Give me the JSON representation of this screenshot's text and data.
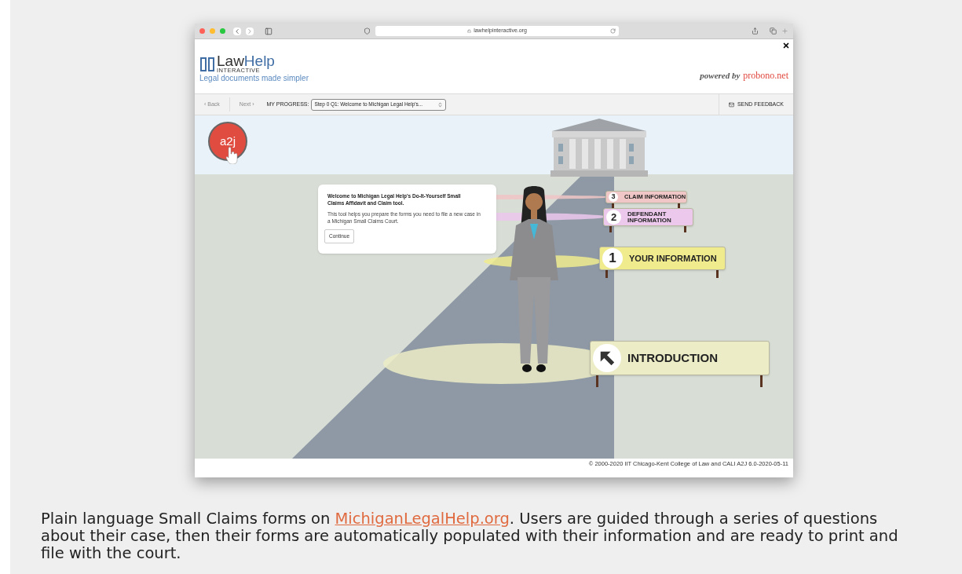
{
  "browser": {
    "url": "lawhelpinteractive.org"
  },
  "header": {
    "logo_a": "Law",
    "logo_b": "Help",
    "logo_sub": "INTERACTIVE",
    "tagline": "Legal documents made simpler",
    "powered_prefix": "powered by",
    "powered_brand": "probono.net"
  },
  "nav": {
    "back": {
      "label": "‹ Back",
      "disabled": true
    },
    "next": {
      "label": "Next ›",
      "disabled": true
    },
    "progress_label": "MY PROGRESS:",
    "progress_value": "Step 0 Q1: Welcome to Michigan Legal Help's...",
    "feedback": "SEND FEEDBACK"
  },
  "badge": "a2j",
  "dialog": {
    "title": "Welcome to Michigan Legal Help's Do-It-Yourself Small Claims Affidavit and Claim tool.",
    "body": "This tool helps you prepare the forms you need to file a new case in a Michigan Small Claims Court.",
    "button": "Continue"
  },
  "signs": [
    {
      "kind": "number",
      "number": "3",
      "label": "CLAIM INFORMATION",
      "color": "#f0c6c6"
    },
    {
      "kind": "number",
      "number": "2",
      "label": "DEFENDANT INFORMATION",
      "color": "#ecc8ec"
    },
    {
      "kind": "number",
      "number": "1",
      "label": "YOUR INFORMATION",
      "color": "#f0ec8e"
    },
    {
      "kind": "arrow",
      "label": "INTRODUCTION",
      "color": "#ececc6"
    }
  ],
  "footer": "© 2000-2020 IIT Chicago-Kent College of Law and CALI A2J 6.0-2020-05-11",
  "caption": {
    "before": "Plain language Small Claims forms on ",
    "link": "MichiganLegalHelp.org",
    "after": ". Users are guided through a series of questions about their case, then their forms are automatically populated with their information and are ready to print and file with the court."
  }
}
